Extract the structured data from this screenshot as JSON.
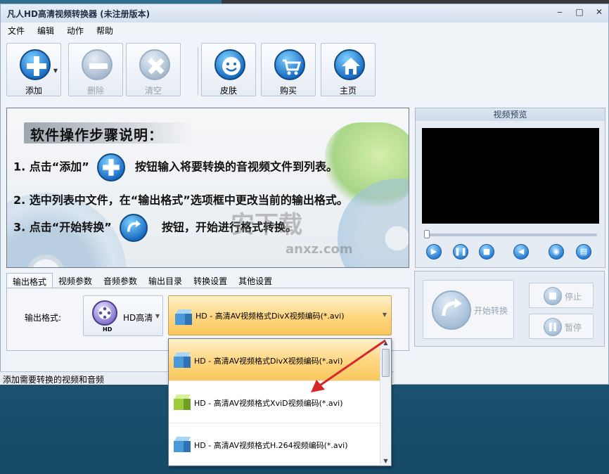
{
  "window": {
    "title": "凡人HD高清视频转换器  (未注册版本)",
    "controls": [
      "minimize-icon",
      "maximize-icon",
      "close-icon"
    ]
  },
  "menu": {
    "items": [
      "文件",
      "编辑",
      "动作",
      "帮助"
    ]
  },
  "toolbar": {
    "add": "添加",
    "delete": "删除",
    "clear": "清空",
    "skin": "皮肤",
    "buy": "购买",
    "home": "主页"
  },
  "instructions": {
    "title": "软件操作步骤说明：",
    "step1_pre": "1. 点击“添加”",
    "step1_post": "按钮输入将要转换的音视频文件到列表。",
    "step2": "2. 选中列表中文件，在“输出格式”选项框中更改当前的输出格式。",
    "step3_pre": "3. 点击“开始转换”",
    "step3_post": "按钮，开始进行格式转换。",
    "watermark": "安下载",
    "watermark_sub": "anxz.com"
  },
  "preview": {
    "title": "视频预览",
    "controls": [
      "play-icon",
      "pause-icon",
      "stop-icon",
      "volume-icon",
      "snapshot-icon",
      "open-folder-icon"
    ]
  },
  "tabs": [
    "输出格式",
    "视频参数",
    "音频参数",
    "输出目录",
    "转换设置",
    "其他设置"
  ],
  "output": {
    "label": "输出格式:",
    "type_name": "HD高清",
    "type_badge": "HD",
    "selected": "HD - 高清AV视频格式DivX视频编码(*.avi)"
  },
  "dropdown": {
    "options": [
      "HD - 高清AV视频格式DivX视频编码(*.avi)",
      "HD - 高清AV视频格式XviD视频编码(*.avi)",
      "HD - 高清AV视频格式H.264视频编码(*.avi)"
    ],
    "selected_index": 0
  },
  "actions": {
    "start": "开始转换",
    "stop": "停止",
    "pause": "暂停"
  },
  "status": {
    "text": "添加需要转换的视频和音频"
  },
  "colors": {
    "highlight": "#ffd680",
    "arrow": "#d6262a",
    "accent": "#1d6fc5"
  }
}
